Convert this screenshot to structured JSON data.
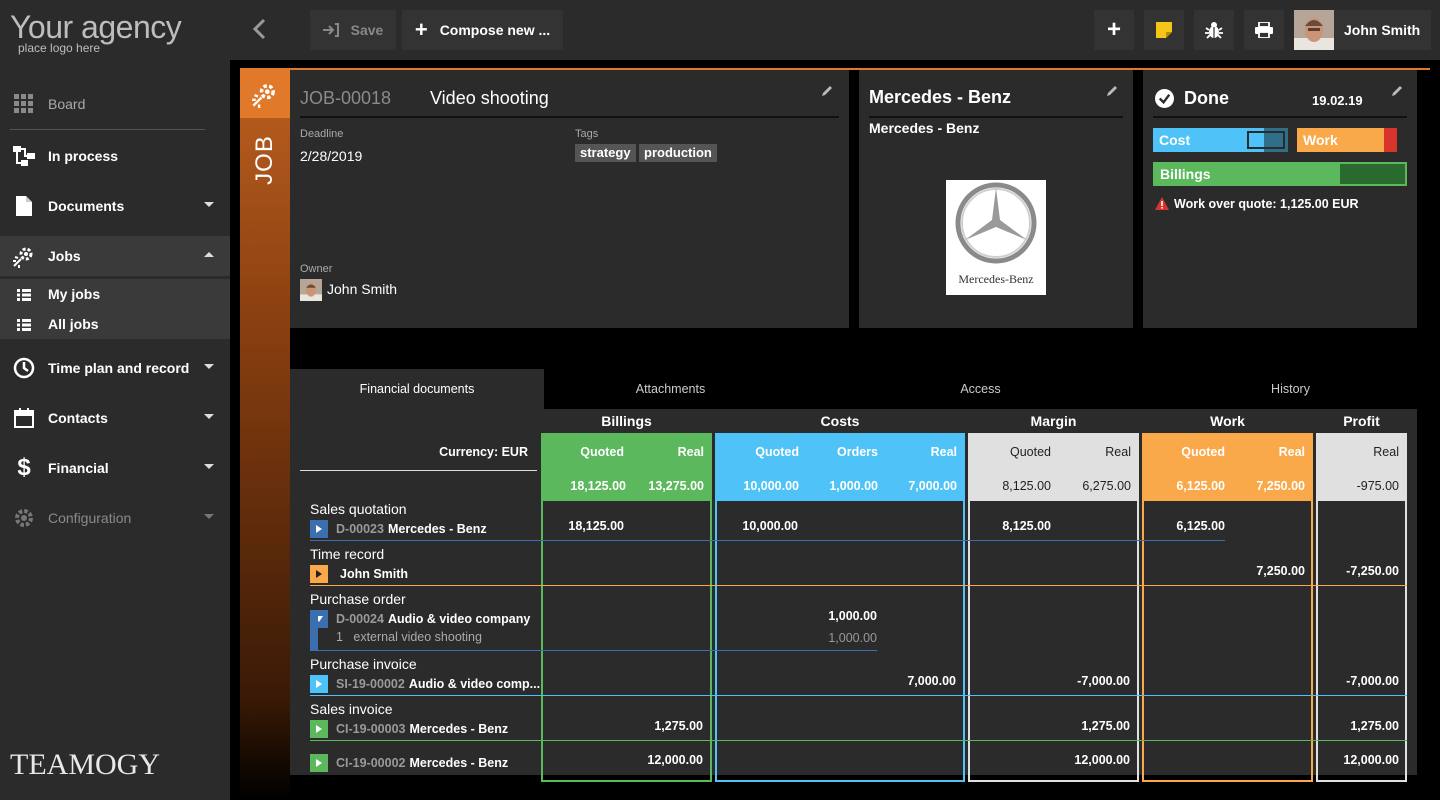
{
  "sidebar": {
    "logo_title": "Your agency",
    "logo_sub": "place logo here",
    "items": [
      {
        "label": "Board"
      },
      {
        "label": "In process"
      },
      {
        "label": "Documents"
      },
      {
        "label": "Jobs"
      },
      {
        "label": "My jobs"
      },
      {
        "label": "All jobs"
      },
      {
        "label": "Time plan and record"
      },
      {
        "label": "Contacts"
      },
      {
        "label": "Financial"
      },
      {
        "label": "Configuration"
      }
    ],
    "brand": "TEAMOGY"
  },
  "topbar": {
    "save_label": "Save",
    "compose_label": "Compose new ...",
    "user_name": "John Smith"
  },
  "job": {
    "side_label": "JOB",
    "code": "JOB-00018",
    "title": "Video shooting",
    "deadline_label": "Deadline",
    "deadline": "2/28/2019",
    "tags_label": "Tags",
    "tags": [
      "strategy",
      "production"
    ],
    "owner_label": "Owner",
    "owner": "John Smith"
  },
  "client": {
    "title": "Mercedes - Benz",
    "subtitle": "Mercedes - Benz",
    "logo_text": "Mercedes-Benz"
  },
  "status": {
    "label": "Done",
    "date": "19.02.19",
    "cost_label": "Cost",
    "cost_fill": 0.82,
    "work_label": "Work",
    "work_fill": 0.87,
    "billings_label": "Billings",
    "billings_fill": 0.74,
    "warning": "Work over quote: 1,125.00 EUR",
    "colors": {
      "cost": "#4fc3f7",
      "work": "#f9a84a",
      "billings": "#5cb85c",
      "danger": "#d9342b"
    }
  },
  "tabs": [
    "Financial documents",
    "Attachments",
    "Access",
    "History"
  ],
  "fin": {
    "currency": "Currency: EUR",
    "groups": {
      "billings": "Billings",
      "costs": "Costs",
      "margin": "Margin",
      "work": "Work",
      "profit": "Profit"
    },
    "cols": {
      "quoted": "Quoted",
      "real": "Real",
      "orders": "Orders"
    },
    "totals": {
      "bill_q": "18,125.00",
      "bill_r": "13,275.00",
      "cost_q": "10,000.00",
      "cost_o": "1,000.00",
      "cost_r": "7,000.00",
      "marg_q": "8,125.00",
      "marg_r": "6,275.00",
      "work_q": "6,125.00",
      "work_r": "7,250.00",
      "profit": "-975.00"
    },
    "rows": {
      "sq_title": "Sales quotation",
      "sq_code": "D-00023",
      "sq_name": "Mercedes - Benz",
      "sq_bill": "18,125.00",
      "sq_cost": "10,000.00",
      "sq_marg": "8,125.00",
      "sq_work": "6,125.00",
      "tr_title": "Time record",
      "tr_name": "John Smith",
      "tr_work": "7,250.00",
      "tr_profit": "-7,250.00",
      "po_title": "Purchase order",
      "po_code": "D-00024",
      "po_name": "Audio & video company",
      "po_line": "1   external video shooting",
      "po_orders": "1,000.00",
      "po_orders2": "1,000.00",
      "pi_title": "Purchase invoice",
      "pi_code": "SI-19-00002",
      "pi_name": "Audio & video comp...",
      "pi_cost": "7,000.00",
      "pi_marg": "-7,000.00",
      "pi_profit": "-7,000.00",
      "si_title": "Sales invoice",
      "si1_code": "CI-19-00003",
      "si1_name": "Mercedes - Benz",
      "si1_bill": "1,275.00",
      "si1_marg": "1,275.00",
      "si1_profit": "1,275.00",
      "si2_code": "CI-19-00002",
      "si2_name": "Mercedes - Benz",
      "si2_bill": "12,000.00",
      "si2_marg": "12,000.00",
      "si2_profit": "12,000.00"
    }
  }
}
